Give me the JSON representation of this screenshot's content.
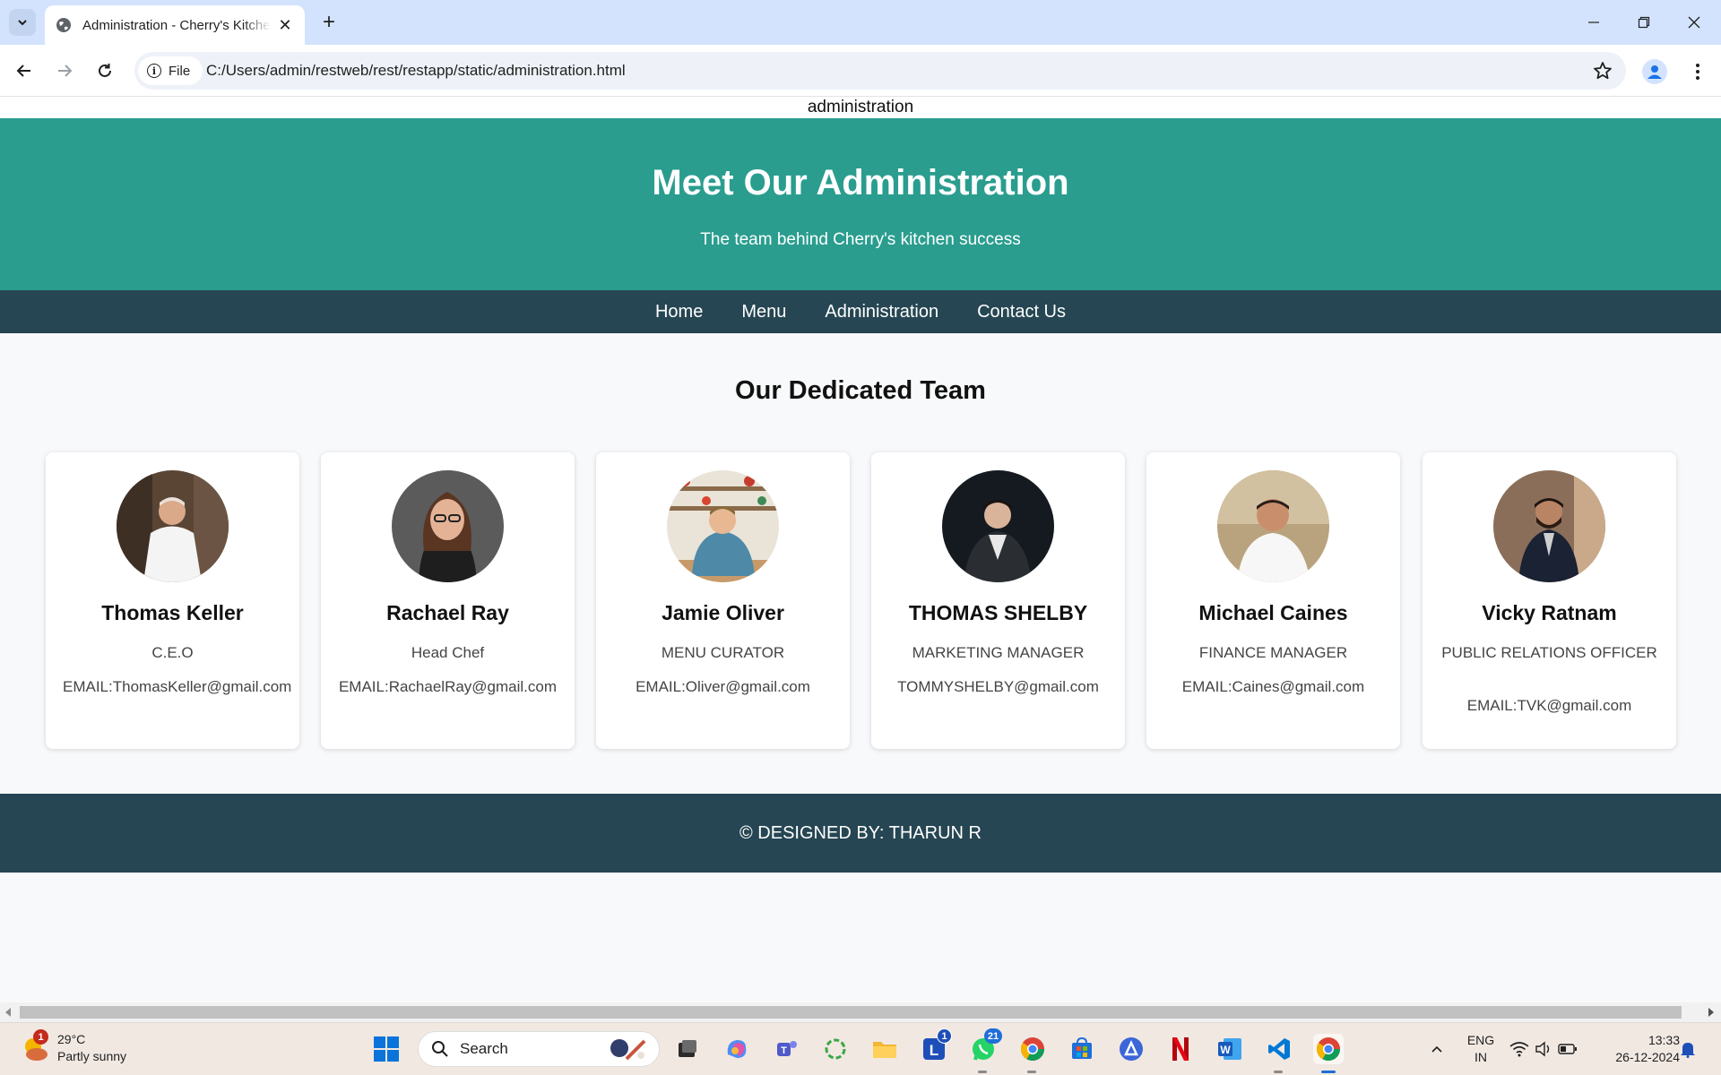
{
  "browser": {
    "tab_title": "Administration - Cherry's Kitchen",
    "url_chip": "File",
    "url": "C:/Users/admin/restweb/rest/restapp/static/administration.html"
  },
  "page": {
    "label": "administration",
    "hero_title": "Meet Our Administration",
    "hero_subtitle": "The team behind Cherry's kitchen success",
    "nav": [
      "Home",
      "Menu",
      "Administration",
      "Contact Us"
    ],
    "section_title": "Our Dedicated Team",
    "team": [
      {
        "name": "Thomas Keller",
        "role": "C.E.O",
        "email": "EMAIL:ThomasKeller@gmail.com"
      },
      {
        "name": "Rachael Ray",
        "role": "Head Chef",
        "email": "EMAIL:RachaelRay@gmail.com"
      },
      {
        "name": "Jamie Oliver",
        "role": "MENU CURATOR",
        "email": "EMAIL:Oliver@gmail.com"
      },
      {
        "name": "THOMAS SHELBY",
        "role": "MARKETING MANAGER",
        "email": "TOMMYSHELBY@gmail.com"
      },
      {
        "name": "Michael Caines",
        "role": "FINANCE MANAGER",
        "email": "EMAIL:Caines@gmail.com"
      },
      {
        "name": "Vicky Ratnam",
        "role": "PUBLIC RELATIONS OFFICER",
        "email": "EMAIL:TVK@gmail.com"
      }
    ],
    "footer": "© DESIGNED BY: THARUN R"
  },
  "taskbar": {
    "weather_temp": "29°C",
    "weather_desc": "Partly sunny",
    "weather_badge": "1",
    "search_placeholder": "Search",
    "l_badge": "1",
    "whatsapp_badge": "21",
    "lang_line1": "ENG",
    "lang_line2": "IN",
    "time": "13:33",
    "date": "26-12-2024"
  },
  "colors": {
    "hero": "#2a9d8f",
    "nav": "#264653",
    "footer": "#264653"
  }
}
